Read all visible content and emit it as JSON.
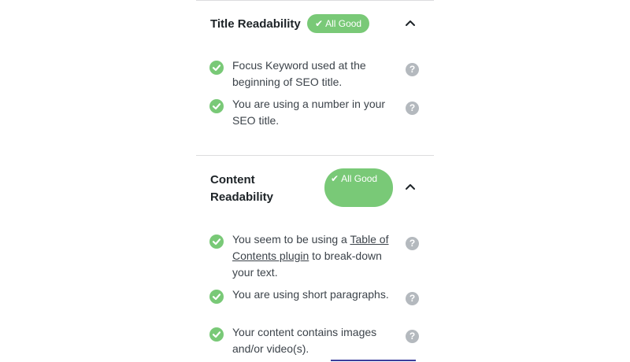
{
  "sections": [
    {
      "title": "Title Readability",
      "badge": "All Good",
      "items": [
        {
          "text": "Focus Keyword used at the beginning of SEO title."
        },
        {
          "text": "You are using a number in your SEO title."
        }
      ]
    },
    {
      "title": "Content Readability",
      "badge": "All Good",
      "items": [
        {
          "before": "You seem to be using a ",
          "link": "Table of Contents plugin",
          "after": " to break-down your text."
        },
        {
          "text": "You are using short paragraphs."
        },
        {
          "text": "Your content contains images and/or video(s)."
        }
      ]
    }
  ],
  "icons": {
    "check": "check-circle-icon",
    "help": "question-mark-icon",
    "chevron": "chevron-up-icon",
    "badge_tick": "checkmark-icon"
  },
  "help_glyph": "?",
  "badge_tick_glyph": "✔",
  "colors": {
    "success": "#79c977",
    "help": "#b4b9be",
    "text": "#3c434a",
    "heading": "#1d2327",
    "divider": "#dcdcde"
  }
}
